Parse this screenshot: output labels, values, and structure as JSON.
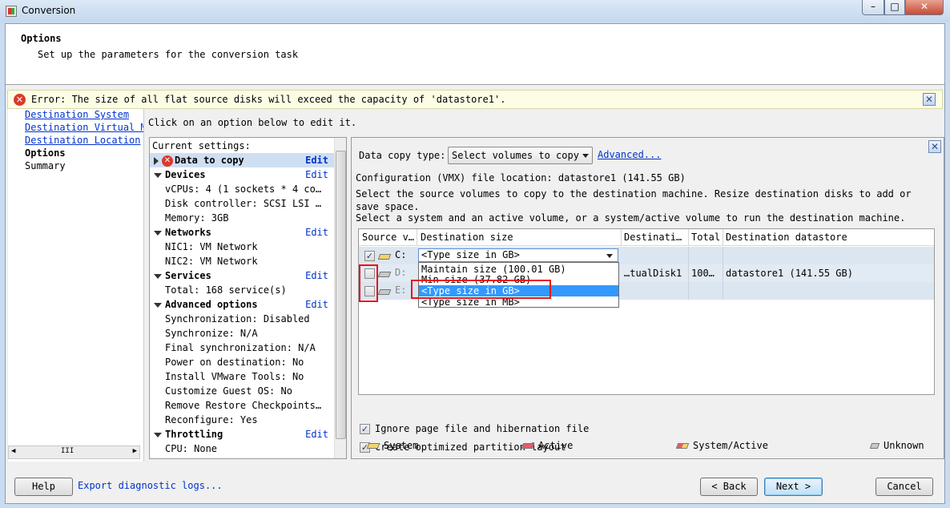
{
  "window": {
    "title": "Conversion",
    "min_glyph": "–",
    "max_glyph": "□",
    "close_glyph": "✕"
  },
  "header": {
    "title": "Options",
    "subtitle": "Set up the parameters for the conversion task"
  },
  "error": {
    "icon_glyph": "✕",
    "text": "Error: The size of all flat source disks will exceed the capacity of 'datastore1'.",
    "close_glyph": "✕"
  },
  "nav": {
    "items": [
      {
        "label": "Destination System"
      },
      {
        "label": "Destination Virtual Machine"
      },
      {
        "label": "Destination Location"
      },
      {
        "label": "Options"
      },
      {
        "label": "Summary"
      }
    ],
    "scroll_grip": "III"
  },
  "main": {
    "hint": "Click on an option below to edit it."
  },
  "settings": {
    "header": "Current settings:",
    "edit_label": "Edit",
    "sections": [
      {
        "title": "Data to copy"
      },
      {
        "title": "Devices",
        "details": [
          "vCPUs: 4 (1 sockets * 4 co…",
          "Disk controller: SCSI LSI …",
          "Memory: 3GB"
        ]
      },
      {
        "title": "Networks",
        "details": [
          "NIC1: VM Network",
          "NIC2: VM Network"
        ]
      },
      {
        "title": "Services",
        "details": [
          "Total: 168 service(s)"
        ]
      },
      {
        "title": "Advanced options",
        "details": [
          "Synchronization: Disabled",
          "Synchronize: N/A",
          "Final synchronization: N/A",
          "Power on destination: No",
          "Install VMware Tools: No",
          "Customize Guest OS: No",
          "Remove Restore Checkpoints…",
          "Reconfigure: Yes"
        ]
      },
      {
        "title": "Throttling",
        "details": [
          "CPU: None"
        ]
      }
    ]
  },
  "panel": {
    "data_copy_type_label": "Data copy type:",
    "data_copy_type_value": "Select volumes to copy",
    "advanced_link": "Advanced...",
    "config_location": "Configuration (VMX) file location: datastore1 (141.55 GB)",
    "description_1": "Select the source volumes to copy to the destination machine. Resize destination disks to add or save space.",
    "description_2": "Select a system and an active volume, or a system/active volume to run the destination machine.",
    "table": {
      "columns": [
        "Source v…",
        "Destination size",
        "Destinati…",
        "Total",
        "Destination datastore"
      ],
      "rows": [
        {
          "checked": true,
          "checkmark": "✓",
          "volume": "C:"
        },
        {
          "checked": false,
          "volume": "D:",
          "destination": "…tualDisk1",
          "total": "100…",
          "datastore": "datastore1 (141.55 GB)"
        },
        {
          "checked": false,
          "volume": "E:"
        }
      ],
      "combo_value": "<Type size in GB>",
      "dropdown_options": [
        "Maintain size (100.01 GB)",
        "Min size (37.82 GB)",
        "<Type size in GB>",
        "<Type size in MB>"
      ],
      "dropdown_selected_index": 2
    },
    "ignore_pagefile_label": "Ignore page file and hibernation file",
    "optimized_layout_label": "Create optimized partition layout",
    "legend": [
      {
        "label": "System",
        "icon": "system-volume-icon",
        "color": "#f3d36a"
      },
      {
        "label": "Active",
        "icon": "active-volume-icon",
        "color": "#e55b6b"
      },
      {
        "label": "System/Active",
        "icon": "system-active-volume-icon"
      },
      {
        "label": "Unknown",
        "icon": "unknown-volume-icon"
      }
    ]
  },
  "buttons": {
    "help": "Help",
    "export": "Export diagnostic logs...",
    "back": "< Back",
    "next": "Next >",
    "cancel": "Cancel"
  },
  "colors": {
    "link": "#0033cc",
    "error_icon": "#d93a2b",
    "selection": "#3399ff",
    "highlight_box": "#e8141a"
  }
}
